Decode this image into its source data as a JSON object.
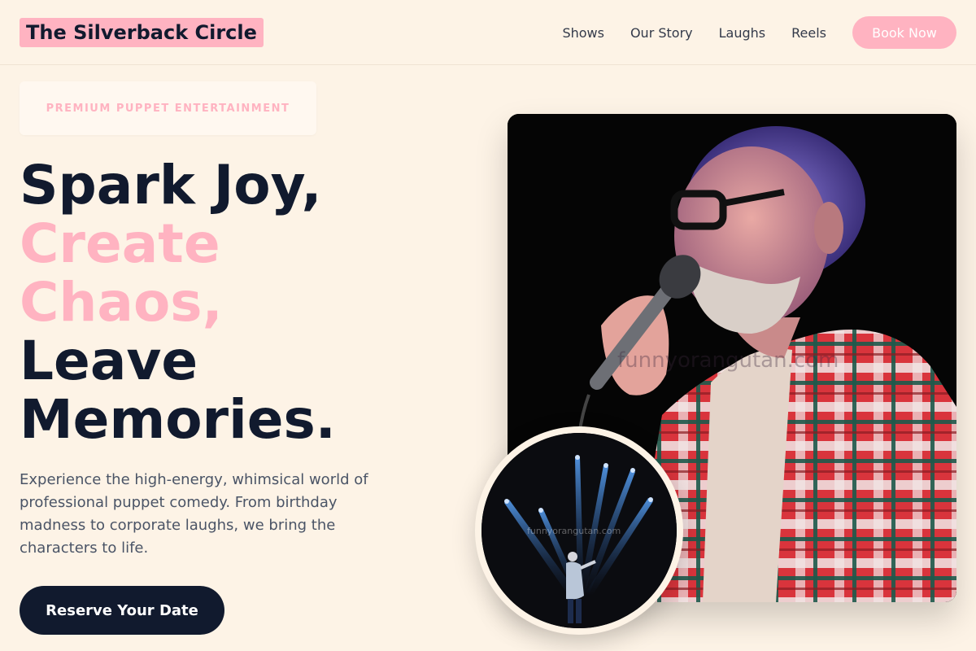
{
  "brand": {
    "name": "The Silverback Circle"
  },
  "nav": {
    "links": [
      "Shows",
      "Our Story",
      "Laughs",
      "Reels"
    ],
    "cta": "Book Now"
  },
  "hero": {
    "badge": "PREMIUM PUPPET ENTERTAINMENT",
    "headline": {
      "line1": "Spark Joy,",
      "line2": "Create",
      "line3": "Chaos,",
      "line4": "Leave",
      "line5": "Memories."
    },
    "description": "Experience the high-energy, whimsical world of professional puppet comedy. From birthday madness to corporate laughs, we bring the characters to life.",
    "cta": "Reserve Your Date"
  },
  "media": {
    "main_photo": {
      "watermark": "funnyorangutan.com"
    },
    "circle_photo": {
      "watermark": "funnyorangutan.com"
    }
  },
  "colors": {
    "background": "#fdf3e6",
    "accent_pink": "#ffb3c1",
    "navy": "#111a2e",
    "body_text": "#4a5466"
  }
}
